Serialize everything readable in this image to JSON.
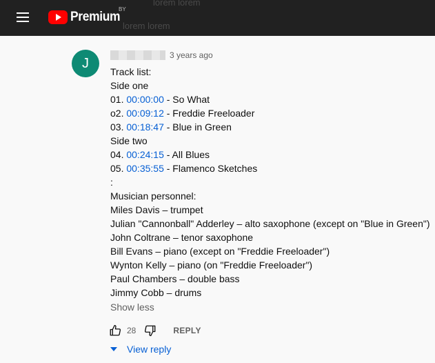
{
  "header": {
    "brand": "Premium",
    "brand_suffix": "BY",
    "ghost_line_1": "lorem lorem",
    "ghost_line_2": "lorem lorem"
  },
  "comment": {
    "avatar_letter": "J",
    "timestamp": "3 years ago",
    "track_list_title": "Track list:",
    "side_one": "Side one",
    "tracks_side_one": [
      {
        "num": "01.",
        "time": "00:00:00",
        "title": "- So What"
      },
      {
        "num": "o2.",
        "time": "00:09:12",
        "title": "- Freddie Freeloader"
      },
      {
        "num": "03.",
        "time": "00:18:47",
        "title": "- Blue in Green"
      }
    ],
    "side_two": "Side two",
    "tracks_side_two": [
      {
        "num": "04.",
        "time": "00:24:15",
        "title": "- All Blues"
      },
      {
        "num": "05.",
        "time": "00:35:55",
        "title": "- Flamenco Sketches"
      }
    ],
    "separator": ":",
    "personnel_title": "Musician personnel:",
    "personnel": [
      "Miles Davis – trumpet",
      "Julian \"Cannonball\" Adderley – alto saxophone (except on \"Blue in Green\")",
      "John Coltrane – tenor saxophone",
      "Bill Evans – piano (except on \"Freddie Freeloader\")",
      "Wynton Kelly – piano (on \"Freddie Freeloader\")",
      "Paul Chambers – double bass",
      "Jimmy Cobb – drums"
    ],
    "show_less": "Show less",
    "like_count": "28",
    "reply_label": "REPLY",
    "view_reply_label": "View reply"
  },
  "icons": {
    "menu": "hamburger-menu-icon",
    "like": "thumb-up-icon",
    "dislike": "thumb-down-icon",
    "expand": "caret-down-icon"
  },
  "colors": {
    "topbar": "#212121",
    "brand_red": "#ff0000",
    "avatar": "#0e8a74",
    "link": "#065fd4",
    "secondary_text": "#606060"
  }
}
